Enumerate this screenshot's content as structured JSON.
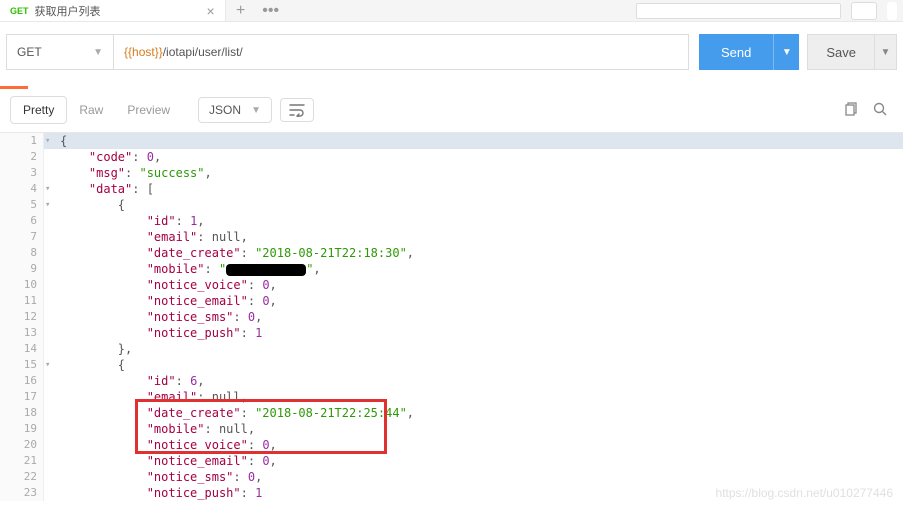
{
  "tab": {
    "method": "GET",
    "name": "获取用户列表"
  },
  "request": {
    "method": "GET",
    "host_var": "{{host}}",
    "path": "/iotapi/user/list/",
    "send": "Send",
    "save": "Save"
  },
  "resp_tabs": {
    "pretty": "Pretty",
    "raw": "Raw",
    "preview": "Preview",
    "format": "JSON"
  },
  "json": [
    {
      "ln": "1",
      "fold": "▾",
      "indent": 0,
      "tokens": [
        {
          "t": "{",
          "c": "p"
        }
      ],
      "hl": true
    },
    {
      "ln": "2",
      "fold": "",
      "indent": 1,
      "tokens": [
        {
          "t": "\"code\"",
          "c": "k"
        },
        {
          "t": ": ",
          "c": "p"
        },
        {
          "t": "0",
          "c": "n"
        },
        {
          "t": ",",
          "c": "p"
        }
      ]
    },
    {
      "ln": "3",
      "fold": "",
      "indent": 1,
      "tokens": [
        {
          "t": "\"msg\"",
          "c": "k"
        },
        {
          "t": ": ",
          "c": "p"
        },
        {
          "t": "\"success\"",
          "c": "s"
        },
        {
          "t": ",",
          "c": "p"
        }
      ]
    },
    {
      "ln": "4",
      "fold": "▾",
      "indent": 1,
      "tokens": [
        {
          "t": "\"data\"",
          "c": "k"
        },
        {
          "t": ": [",
          "c": "p"
        }
      ]
    },
    {
      "ln": "5",
      "fold": "▾",
      "indent": 2,
      "tokens": [
        {
          "t": "{",
          "c": "p"
        }
      ]
    },
    {
      "ln": "6",
      "fold": "",
      "indent": 3,
      "tokens": [
        {
          "t": "\"id\"",
          "c": "k"
        },
        {
          "t": ": ",
          "c": "p"
        },
        {
          "t": "1",
          "c": "n"
        },
        {
          "t": ",",
          "c": "p"
        }
      ]
    },
    {
      "ln": "7",
      "fold": "",
      "indent": 3,
      "tokens": [
        {
          "t": "\"email\"",
          "c": "k"
        },
        {
          "t": ": ",
          "c": "p"
        },
        {
          "t": "null",
          "c": "nu"
        },
        {
          "t": ",",
          "c": "p"
        }
      ]
    },
    {
      "ln": "8",
      "fold": "",
      "indent": 3,
      "tokens": [
        {
          "t": "\"date_create\"",
          "c": "k"
        },
        {
          "t": ": ",
          "c": "p"
        },
        {
          "t": "\"2018-08-21T22:18:30\"",
          "c": "s"
        },
        {
          "t": ",",
          "c": "p"
        }
      ]
    },
    {
      "ln": "9",
      "fold": "",
      "indent": 3,
      "tokens": [
        {
          "t": "\"mobile\"",
          "c": "k"
        },
        {
          "t": ": ",
          "c": "p"
        },
        {
          "t": "\"",
          "c": "s"
        },
        {
          "t": "",
          "c": "redact"
        },
        {
          "t": "\"",
          "c": "s"
        },
        {
          "t": ",",
          "c": "p"
        }
      ]
    },
    {
      "ln": "10",
      "fold": "",
      "indent": 3,
      "tokens": [
        {
          "t": "\"notice_voice\"",
          "c": "k"
        },
        {
          "t": ": ",
          "c": "p"
        },
        {
          "t": "0",
          "c": "n"
        },
        {
          "t": ",",
          "c": "p"
        }
      ]
    },
    {
      "ln": "11",
      "fold": "",
      "indent": 3,
      "tokens": [
        {
          "t": "\"notice_email\"",
          "c": "k"
        },
        {
          "t": ": ",
          "c": "p"
        },
        {
          "t": "0",
          "c": "n"
        },
        {
          "t": ",",
          "c": "p"
        }
      ]
    },
    {
      "ln": "12",
      "fold": "",
      "indent": 3,
      "tokens": [
        {
          "t": "\"notice_sms\"",
          "c": "k"
        },
        {
          "t": ": ",
          "c": "p"
        },
        {
          "t": "0",
          "c": "n"
        },
        {
          "t": ",",
          "c": "p"
        }
      ]
    },
    {
      "ln": "13",
      "fold": "",
      "indent": 3,
      "tokens": [
        {
          "t": "\"notice_push\"",
          "c": "k"
        },
        {
          "t": ": ",
          "c": "p"
        },
        {
          "t": "1",
          "c": "n"
        }
      ]
    },
    {
      "ln": "14",
      "fold": "",
      "indent": 2,
      "tokens": [
        {
          "t": "},",
          "c": "p"
        }
      ]
    },
    {
      "ln": "15",
      "fold": "▾",
      "indent": 2,
      "tokens": [
        {
          "t": "{",
          "c": "p"
        }
      ]
    },
    {
      "ln": "16",
      "fold": "",
      "indent": 3,
      "tokens": [
        {
          "t": "\"id\"",
          "c": "k"
        },
        {
          "t": ": ",
          "c": "p"
        },
        {
          "t": "6",
          "c": "n"
        },
        {
          "t": ",",
          "c": "p"
        }
      ]
    },
    {
      "ln": "17",
      "fold": "",
      "indent": 3,
      "tokens": [
        {
          "t": "\"email\"",
          "c": "k"
        },
        {
          "t": ": ",
          "c": "p"
        },
        {
          "t": "null",
          "c": "nu"
        },
        {
          "t": ",",
          "c": "p"
        }
      ]
    },
    {
      "ln": "18",
      "fold": "",
      "indent": 3,
      "tokens": [
        {
          "t": "\"date_create\"",
          "c": "k"
        },
        {
          "t": ": ",
          "c": "p"
        },
        {
          "t": "\"2018-08-21T22:25:44\"",
          "c": "s"
        },
        {
          "t": ",",
          "c": "p"
        }
      ]
    },
    {
      "ln": "19",
      "fold": "",
      "indent": 3,
      "tokens": [
        {
          "t": "\"mobile\"",
          "c": "k"
        },
        {
          "t": ": ",
          "c": "p"
        },
        {
          "t": "null",
          "c": "nu"
        },
        {
          "t": ",",
          "c": "p"
        }
      ]
    },
    {
      "ln": "20",
      "fold": "",
      "indent": 3,
      "tokens": [
        {
          "t": "\"notice_voice\"",
          "c": "k"
        },
        {
          "t": ": ",
          "c": "p"
        },
        {
          "t": "0",
          "c": "n"
        },
        {
          "t": ",",
          "c": "p"
        }
      ]
    },
    {
      "ln": "21",
      "fold": "",
      "indent": 3,
      "tokens": [
        {
          "t": "\"notice_email\"",
          "c": "k"
        },
        {
          "t": ": ",
          "c": "p"
        },
        {
          "t": "0",
          "c": "n"
        },
        {
          "t": ",",
          "c": "p"
        }
      ]
    },
    {
      "ln": "22",
      "fold": "",
      "indent": 3,
      "tokens": [
        {
          "t": "\"notice_sms\"",
          "c": "k"
        },
        {
          "t": ": ",
          "c": "p"
        },
        {
          "t": "0",
          "c": "n"
        },
        {
          "t": ",",
          "c": "p"
        }
      ]
    },
    {
      "ln": "23",
      "fold": "",
      "indent": 3,
      "tokens": [
        {
          "t": "\"notice_push\"",
          "c": "k"
        },
        {
          "t": ": ",
          "c": "p"
        },
        {
          "t": "1",
          "c": "n"
        }
      ]
    }
  ],
  "watermark": "https://blog.csdn.net/u010277446"
}
